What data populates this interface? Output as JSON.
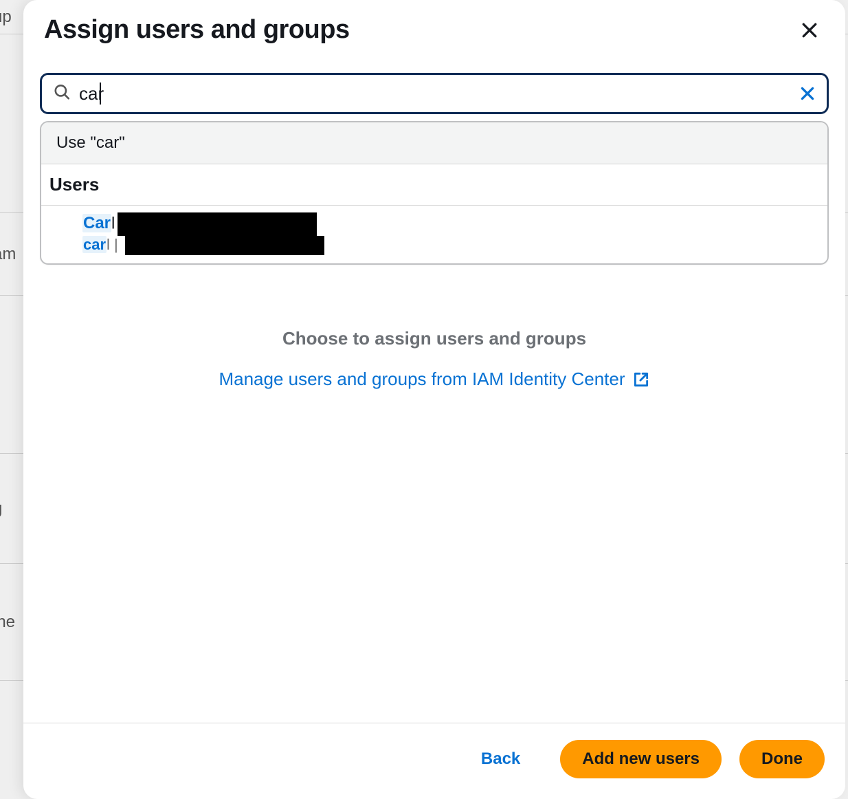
{
  "dialog": {
    "title": "Assign users and groups"
  },
  "search": {
    "value": "car",
    "placeholder": ""
  },
  "dropdown": {
    "use_label": "Use \"car\"",
    "section_label": "Users",
    "user": {
      "name_highlight": "Car",
      "name_rest": "l",
      "uname_highlight": "car",
      "uname_rest": "l",
      "uname_sep": " | "
    }
  },
  "empty": {
    "message": "Choose to assign users and groups",
    "manage_link": "Manage users and groups from IAM Identity Center"
  },
  "footer": {
    "back": "Back",
    "add": "Add new users",
    "done": "Done"
  },
  "bg": {
    "r1": "up",
    "r2": "",
    "r3": "am",
    "r4": "",
    "r5": "g",
    "r6": "ine"
  }
}
